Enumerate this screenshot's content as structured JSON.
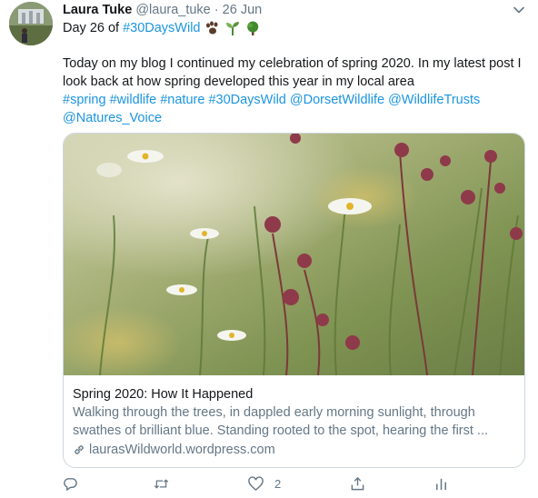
{
  "tweet": {
    "author_name": "Laura Tuke",
    "handle": "@laura_tuke",
    "separator": "·",
    "date": "26 Jun",
    "line2_prefix": "Day 26 of ",
    "hashtag_30": "#30DaysWild",
    "emojis": [
      "paw-icon",
      "seedling-icon",
      "tree-icon"
    ],
    "text_part1": "Today on my blog I continued my celebration of spring 2020. In my latest post I look back at how spring developed this year in my local area",
    "tags": [
      "#spring",
      "#wildlife",
      "#nature",
      "#30DaysWild",
      "@DorsetWildlife",
      "@WildlifeTrusts",
      "@Natures_Voice"
    ]
  },
  "card": {
    "title": "Spring 2020: How It Happened",
    "description": "Walking through the trees, in dappled early morning sunlight, through swathes of brilliant blue. Standing rooted to the spot, hearing the first ...",
    "url": "laurasWildworld.wordpress.com"
  },
  "actions": {
    "reply_icon": "reply-icon",
    "retweet_icon": "retweet-icon",
    "like_icon": "heart-icon",
    "like_count": "2",
    "analytics_icon": "analytics-icon"
  },
  "colors": {
    "link": "#1b95e0",
    "muted": "#657786",
    "text": "#14171a"
  }
}
